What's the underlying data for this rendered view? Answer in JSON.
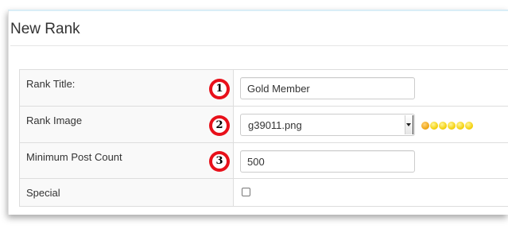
{
  "page": {
    "title": "New Rank"
  },
  "form": {
    "rank_title": {
      "label": "Rank Title:",
      "value": "Gold Member"
    },
    "rank_image": {
      "label": "Rank Image",
      "selected": "g39011.png",
      "preview_icon": "six-gold-dots-rank-image"
    },
    "min_post_count": {
      "label": "Minimum Post Count",
      "value": "500"
    },
    "special": {
      "label": "Special",
      "checked": false
    }
  },
  "badges": [
    "1",
    "2",
    "3"
  ],
  "colors": {
    "badge_red": "#e8101a",
    "panel_top_accent": "#d9eef7",
    "label_cell_bg": "#f9f9f9",
    "dot_orange": "#f0a81a",
    "dot_yellow": "#f5d313"
  }
}
